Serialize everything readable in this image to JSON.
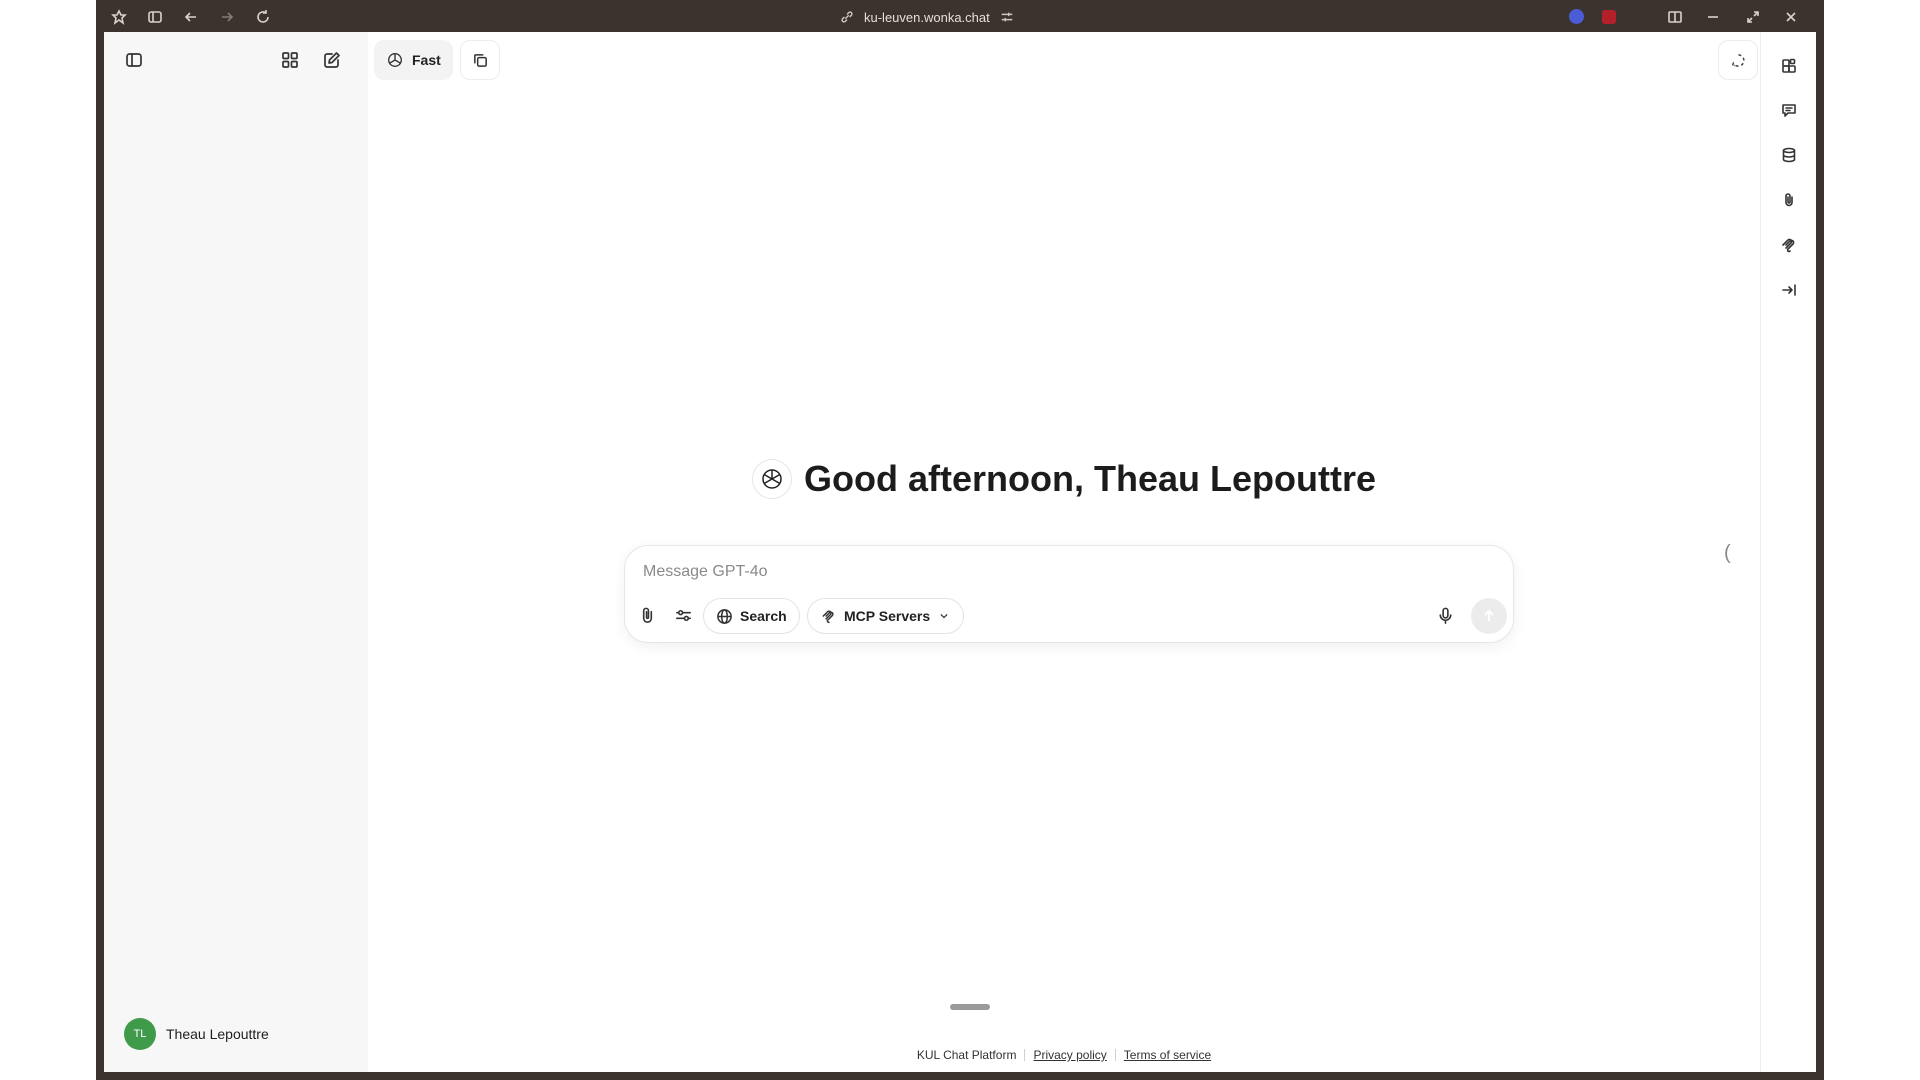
{
  "browser": {
    "url": "ku-leuven.wonka.chat"
  },
  "sidebar": {
    "user_initials": "TL",
    "user_name": "Theau Lepouttre"
  },
  "header": {
    "model_label": "Fast"
  },
  "main": {
    "greeting": "Good afternoon, Theau Lepouttre"
  },
  "composer": {
    "placeholder": "Message GPT-4o",
    "search_label": "Search",
    "mcp_label": "MCP Servers"
  },
  "footer": {
    "platform": "KUL Chat Platform",
    "privacy": "Privacy policy",
    "terms": "Terms of service"
  },
  "colors": {
    "frame": "#3c332f",
    "sidebar_bg": "#f7f7f7",
    "avatar": "#3f9b4a"
  }
}
